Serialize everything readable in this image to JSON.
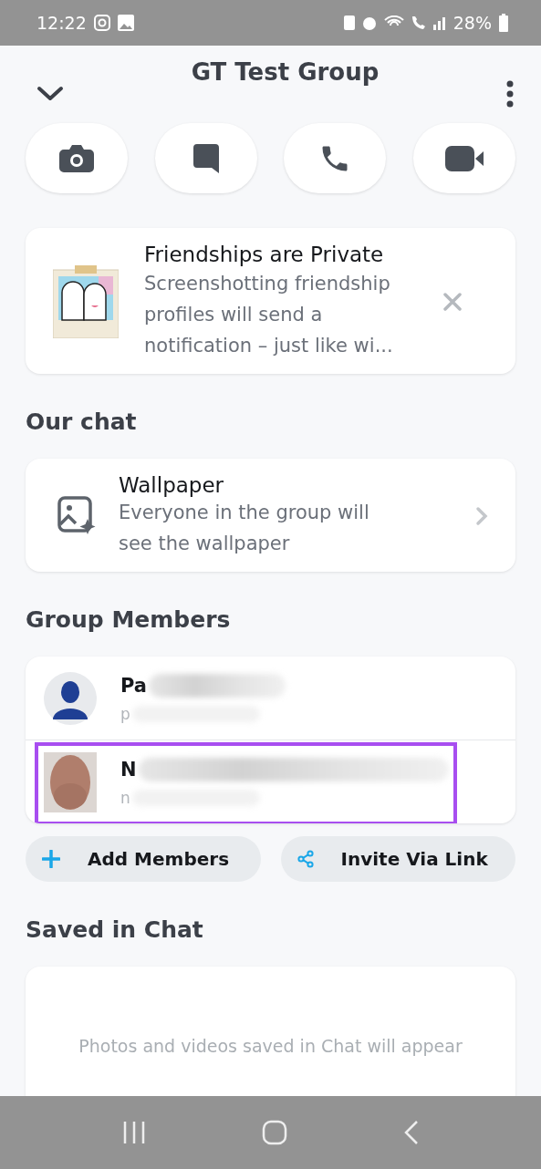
{
  "status_bar": {
    "time": "12:22",
    "battery": "28%"
  },
  "header": {
    "title": "GT Test Group"
  },
  "actions": [
    {
      "kind": "camera"
    },
    {
      "kind": "chat"
    },
    {
      "kind": "call"
    },
    {
      "kind": "video"
    }
  ],
  "notice": {
    "title": "Friendships are Private",
    "body": "Screenshotting friendship profiles will send a notification – just like wi..."
  },
  "our_chat": {
    "heading": "Our chat",
    "item": {
      "title": "Wallpaper",
      "subtitle": "Everyone in the group will see the wallpaper"
    }
  },
  "group_members": {
    "heading": "Group Members",
    "members": [
      {
        "name": "Pa",
        "username": "p",
        "kind": "silhouette",
        "highlighted": false
      },
      {
        "name": "N",
        "username": "n",
        "highlighted": true
      }
    ],
    "buttons": [
      {
        "kind": "add",
        "label": "Add Members"
      },
      {
        "kind": "share",
        "label": "Invite Via Link"
      }
    ]
  },
  "saved": {
    "heading": "Saved in Chat",
    "empty_text": "Photos and videos saved in Chat will appear"
  }
}
